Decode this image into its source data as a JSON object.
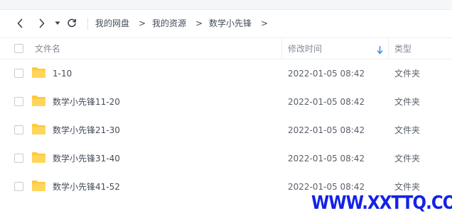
{
  "nav": {
    "back_icon": "chevron-left-icon",
    "forward_icon": "chevron-right-icon",
    "history_icon": "caret-down-icon",
    "refresh_icon": "refresh-icon"
  },
  "breadcrumb": {
    "items": [
      "我的网盘",
      "我的资源",
      "数学小先锋"
    ],
    "separator": ">"
  },
  "table": {
    "columns": {
      "name": "文件名",
      "modified": "修改时间",
      "type": "类型"
    },
    "sort_icon": "arrow-down-icon",
    "rows": [
      {
        "name": "1-10",
        "modified": "2022-01-05 08:42",
        "type": "文件夹"
      },
      {
        "name": "数学小先锋11-20",
        "modified": "2022-01-05 08:42",
        "type": "文件夹"
      },
      {
        "name": "数学小先锋21-30",
        "modified": "2022-01-05 08:42",
        "type": "文件夹"
      },
      {
        "name": "数学小先锋31-40",
        "modified": "2022-01-05 08:42",
        "type": "文件夹"
      },
      {
        "name": "数学小先锋41-52",
        "modified": "2022-01-05 08:42",
        "type": "文件夹"
      }
    ]
  },
  "colors": {
    "folder": "#ffc93c",
    "accent": "#2f8cf0",
    "watermark": "#1422e6"
  },
  "watermark": "WWW.XXTTQ.COM"
}
